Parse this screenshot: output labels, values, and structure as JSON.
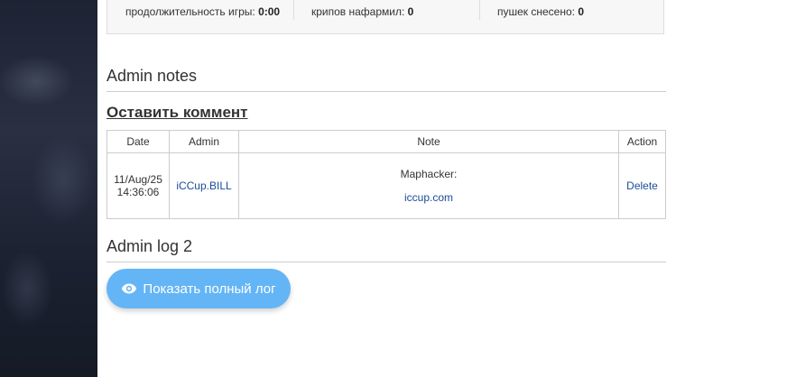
{
  "stats": {
    "duration_label": "продолжительность игры:",
    "duration_value": "0:00",
    "creeps_label": "крипов нафармил:",
    "creeps_value": "0",
    "towers_label": "пушек снесено:",
    "towers_value": "0"
  },
  "admin_notes": {
    "title": "Admin notes",
    "leave_comment": "Оставить коммент",
    "columns": {
      "date": "Date",
      "admin": "Admin",
      "note": "Note",
      "action": "Action"
    },
    "rows": [
      {
        "date_line1": "11/Aug/25",
        "date_line2": "14:36:06",
        "admin": "iCCup.BILL",
        "note_line1": "Maphacker:",
        "note_link": "iccup.com",
        "action": "Delete"
      }
    ]
  },
  "admin_log": {
    "title": "Admin log 2",
    "button_label": "Показать полный лог",
    "button_icon": "eye-icon",
    "button_color": "#64b5f6"
  }
}
